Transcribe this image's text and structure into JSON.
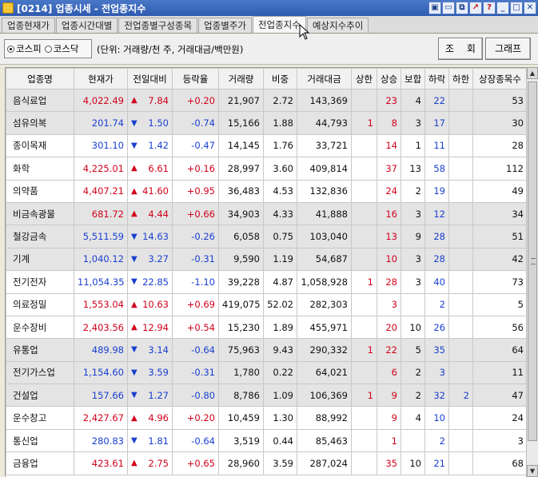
{
  "window": {
    "title": "[0214] 업종시세 - 전업종지수"
  },
  "tabs": [
    {
      "label": "업종현재가"
    },
    {
      "label": "업종시간대별"
    },
    {
      "label": "전업종별구성종목"
    },
    {
      "label": "업종별주가"
    },
    {
      "label": "전업종지수",
      "active": true
    },
    {
      "label": "예상지수추이"
    }
  ],
  "toolbar": {
    "radio_kospi": "코스피",
    "radio_kosdaq": "코스닥",
    "unit": "(단위: 거래량/천 주, 거래대금/백만원)",
    "query_label": "조 회",
    "graph_label": "그래프"
  },
  "table": {
    "headers": [
      "업종명",
      "현재가",
      "전일대비",
      "등락율",
      "거래량",
      "비중",
      "거래대금",
      "상한",
      "상승",
      "보합",
      "하락",
      "하한",
      "상장종목수"
    ],
    "rows": [
      {
        "name": "음식료업",
        "price": "4,022.49",
        "dir": "up",
        "chg": "7.84",
        "rate": "+0.20",
        "vol": "21,907",
        "share": "2.72",
        "amt": "143,369",
        "uplimit": "",
        "rise": "23",
        "flat": "4",
        "fall": "22",
        "downlimit": "",
        "listed": "53"
      },
      {
        "name": "섬유의복",
        "price": "201.74",
        "dir": "down",
        "chg": "1.50",
        "rate": "-0.74",
        "vol": "15,166",
        "share": "1.88",
        "amt": "44,793",
        "uplimit": "1",
        "rise": "8",
        "flat": "3",
        "fall": "17",
        "downlimit": "",
        "listed": "30"
      },
      {
        "name": "종이목재",
        "price": "301.10",
        "dir": "down",
        "chg": "1.42",
        "rate": "-0.47",
        "vol": "14,145",
        "share": "1.76",
        "amt": "33,721",
        "uplimit": "",
        "rise": "14",
        "flat": "1",
        "fall": "11",
        "downlimit": "",
        "listed": "28"
      },
      {
        "name": "화학",
        "price": "4,225.01",
        "dir": "up",
        "chg": "6.61",
        "rate": "+0.16",
        "vol": "28,997",
        "share": "3.60",
        "amt": "409,814",
        "uplimit": "",
        "rise": "37",
        "flat": "13",
        "fall": "58",
        "downlimit": "",
        "listed": "112"
      },
      {
        "name": "의약품",
        "price": "4,407.21",
        "dir": "up",
        "chg": "41.60",
        "rate": "+0.95",
        "vol": "36,483",
        "share": "4.53",
        "amt": "132,836",
        "uplimit": "",
        "rise": "24",
        "flat": "2",
        "fall": "19",
        "downlimit": "",
        "listed": "49"
      },
      {
        "name": "비금속광물",
        "price": "681.72",
        "dir": "up",
        "chg": "4.44",
        "rate": "+0.66",
        "vol": "34,903",
        "share": "4.33",
        "amt": "41,888",
        "uplimit": "",
        "rise": "16",
        "flat": "3",
        "fall": "12",
        "downlimit": "",
        "listed": "34"
      },
      {
        "name": "철강금속",
        "price": "5,511.59",
        "dir": "down",
        "chg": "14.63",
        "rate": "-0.26",
        "vol": "6,058",
        "share": "0.75",
        "amt": "103,040",
        "uplimit": "",
        "rise": "13",
        "flat": "9",
        "fall": "28",
        "downlimit": "",
        "listed": "51"
      },
      {
        "name": "기계",
        "price": "1,040.12",
        "dir": "down",
        "chg": "3.27",
        "rate": "-0.31",
        "vol": "9,590",
        "share": "1.19",
        "amt": "54,687",
        "uplimit": "",
        "rise": "10",
        "flat": "3",
        "fall": "28",
        "downlimit": "",
        "listed": "42"
      },
      {
        "name": "전기전자",
        "price": "11,054.35",
        "dir": "down",
        "chg": "22.85",
        "rate": "-1.10",
        "vol": "39,228",
        "share": "4.87",
        "amt": "1,058,928",
        "uplimit": "1",
        "rise": "28",
        "flat": "3",
        "fall": "40",
        "downlimit": "",
        "listed": "73"
      },
      {
        "name": "의료정밀",
        "price": "1,553.04",
        "dir": "up",
        "chg": "10.63",
        "rate": "+0.69",
        "vol": "419,075",
        "share": "52.02",
        "amt": "282,303",
        "uplimit": "",
        "rise": "3",
        "flat": "",
        "fall": "2",
        "downlimit": "",
        "listed": "5"
      },
      {
        "name": "운수장비",
        "price": "2,403.56",
        "dir": "up",
        "chg": "12.94",
        "rate": "+0.54",
        "vol": "15,230",
        "share": "1.89",
        "amt": "455,971",
        "uplimit": "",
        "rise": "20",
        "flat": "10",
        "fall": "26",
        "downlimit": "",
        "listed": "56"
      },
      {
        "name": "유통업",
        "price": "489.98",
        "dir": "down",
        "chg": "3.14",
        "rate": "-0.64",
        "vol": "75,963",
        "share": "9.43",
        "amt": "290,332",
        "uplimit": "1",
        "rise": "22",
        "flat": "5",
        "fall": "35",
        "downlimit": "",
        "listed": "64"
      },
      {
        "name": "전기가스업",
        "price": "1,154.60",
        "dir": "down",
        "chg": "3.59",
        "rate": "-0.31",
        "vol": "1,780",
        "share": "0.22",
        "amt": "64,021",
        "uplimit": "",
        "rise": "6",
        "flat": "2",
        "fall": "3",
        "downlimit": "",
        "listed": "11"
      },
      {
        "name": "건설업",
        "price": "157.66",
        "dir": "down",
        "chg": "1.27",
        "rate": "-0.80",
        "vol": "8,786",
        "share": "1.09",
        "amt": "106,369",
        "uplimit": "1",
        "rise": "9",
        "flat": "2",
        "fall": "32",
        "downlimit": "2",
        "listed": "47"
      },
      {
        "name": "운수창고",
        "price": "2,427.67",
        "dir": "up",
        "chg": "4.96",
        "rate": "+0.20",
        "vol": "10,459",
        "share": "1.30",
        "amt": "88,992",
        "uplimit": "",
        "rise": "9",
        "flat": "4",
        "fall": "10",
        "downlimit": "",
        "listed": "24"
      },
      {
        "name": "통신업",
        "price": "280.83",
        "dir": "down",
        "chg": "1.81",
        "rate": "-0.64",
        "vol": "3,519",
        "share": "0.44",
        "amt": "85,463",
        "uplimit": "",
        "rise": "1",
        "flat": "",
        "fall": "2",
        "downlimit": "",
        "listed": "3"
      },
      {
        "name": "금융업",
        "price": "423.61",
        "dir": "up",
        "chg": "2.75",
        "rate": "+0.65",
        "vol": "28,960",
        "share": "3.59",
        "amt": "287,024",
        "uplimit": "",
        "rise": "35",
        "flat": "10",
        "fall": "21",
        "downlimit": "",
        "listed": "68"
      }
    ]
  },
  "colors": {
    "up": "#d0021b",
    "down": "#1a3fd0",
    "shade_row": "#e4e4e4"
  },
  "icons": [
    "app-icon",
    "window-minimize-icon",
    "window-restore-icon",
    "window-close-icon"
  ]
}
